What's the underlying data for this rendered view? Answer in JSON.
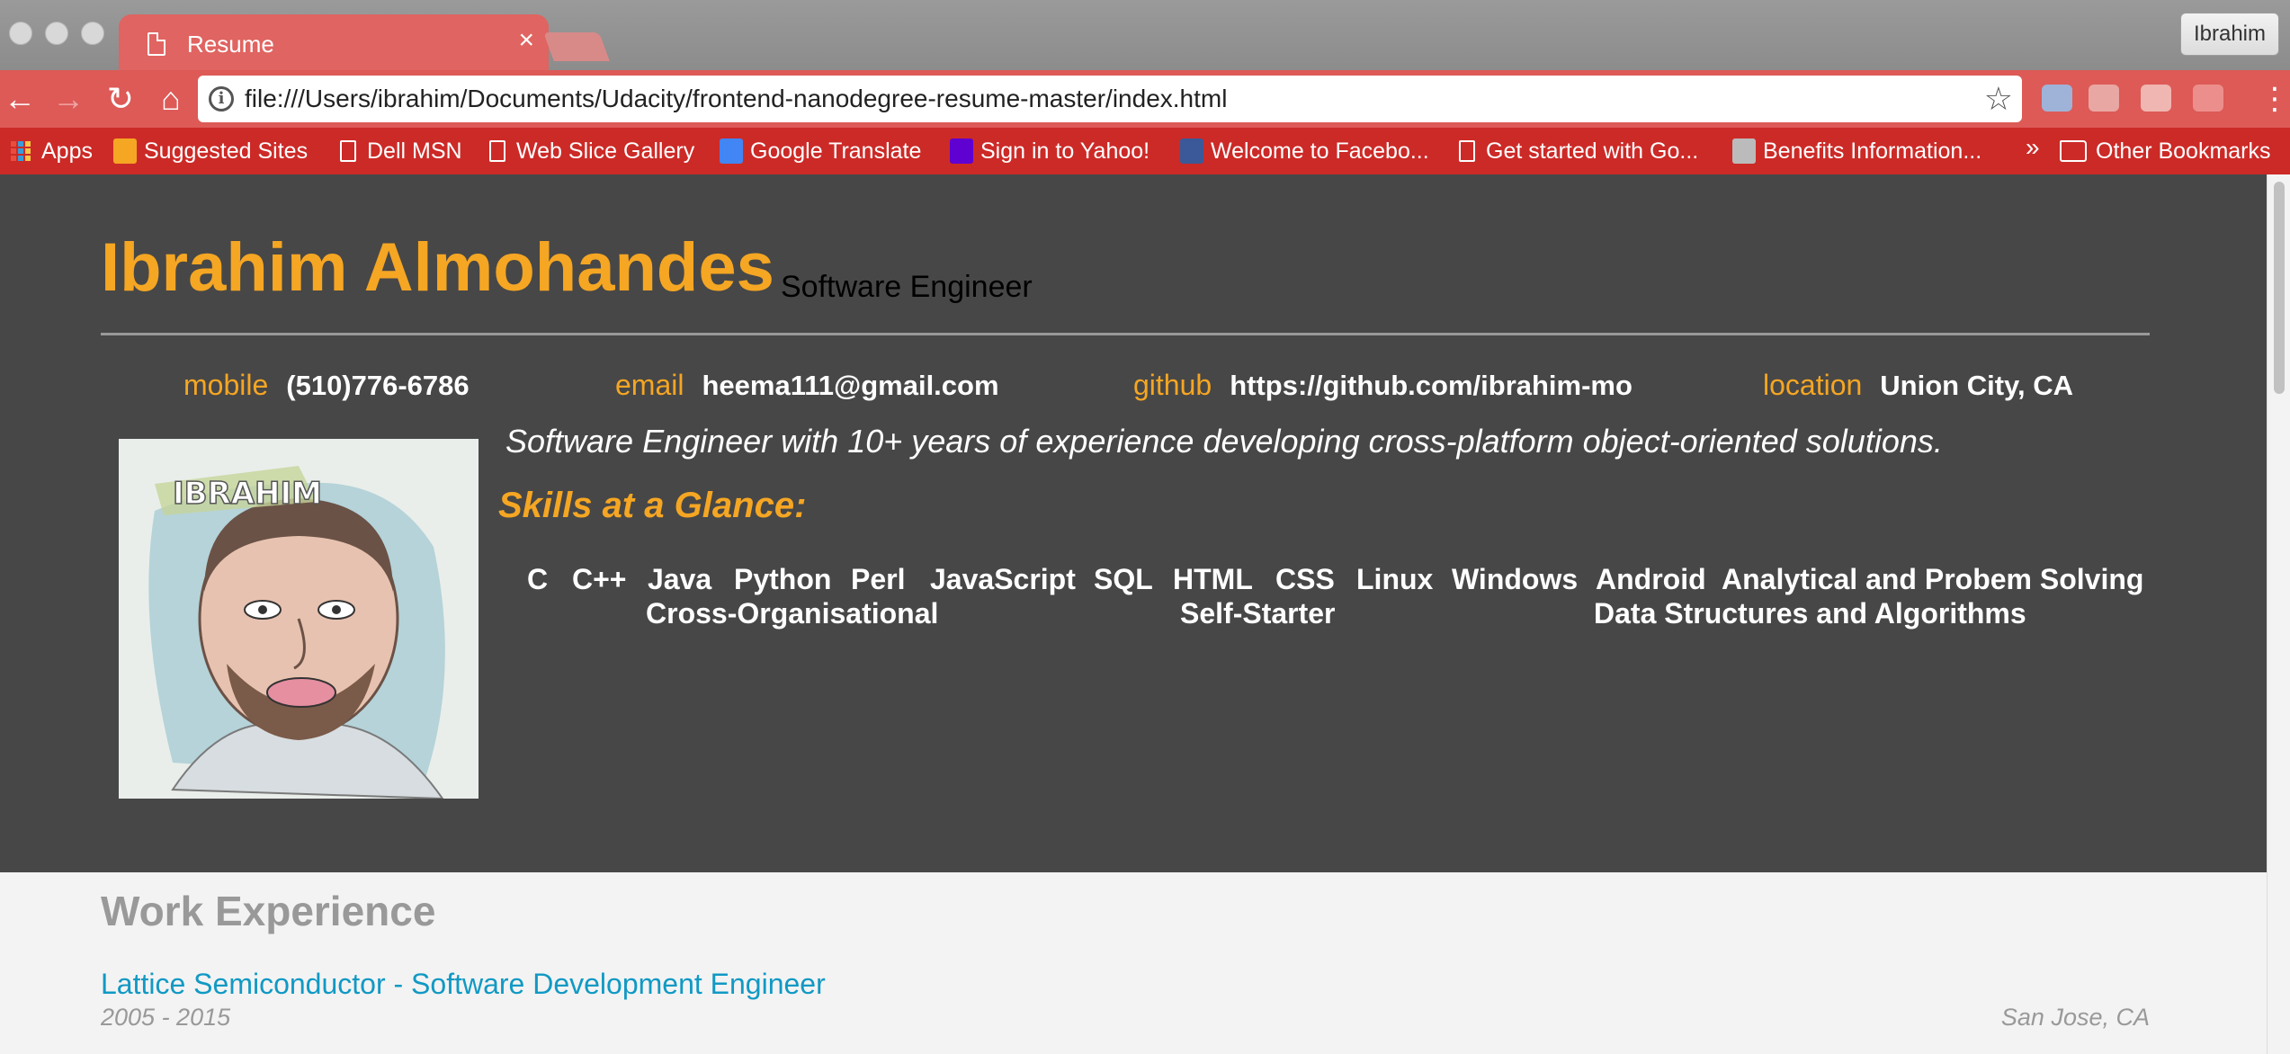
{
  "browser": {
    "tab_title": "Resume",
    "tab_close": "×",
    "profile_name": "Ibrahim",
    "url": "file:///Users/ibrahim/Documents/Udacity/frontend-nanodegree-resume-master/index.html",
    "bookmarks": [
      "Apps",
      "Suggested Sites",
      "Dell MSN",
      "Web Slice Gallery",
      "Google Translate",
      "Sign in to Yahoo!",
      "Welcome to Facebo...",
      "Get started with Go...",
      "Benefits Information...",
      "Other Bookmarks"
    ],
    "overflow_chevron": "»",
    "accent_color": "#dd5a57"
  },
  "header": {
    "name": "Ibrahim Almohandes",
    "role": "Software Engineer",
    "contacts": [
      {
        "label": "mobile",
        "value": "(510)776-6786"
      },
      {
        "label": "email",
        "value": "heema111@gmail.com"
      },
      {
        "label": "github",
        "value": "https://github.com/ibrahim-mo"
      },
      {
        "label": "location",
        "value": "Union City, CA"
      }
    ],
    "welcome_message": "Software Engineer with 10+ years of experience developing cross-platform object-oriented solutions.",
    "skills_heading": "Skills at a Glance:",
    "skills": [
      "C",
      "C++",
      "Java",
      "Python",
      "Perl",
      "JavaScript",
      "SQL",
      "HTML",
      "CSS",
      "Linux",
      "Windows",
      "Android",
      "Analytical and Probem Solving",
      "Cross-Organisational",
      "Self-Starter",
      "Data Structures and Algorithms"
    ],
    "photo_caption": "IBRAHIM",
    "accent_color": "#f5a623"
  },
  "work": {
    "heading": "Work Experience",
    "jobs": [
      {
        "title": "Lattice Semiconductor - Software Development Engineer",
        "dates": "2005 - 2015",
        "location": "San Jose, CA"
      }
    ],
    "link_color": "#1199c4"
  }
}
